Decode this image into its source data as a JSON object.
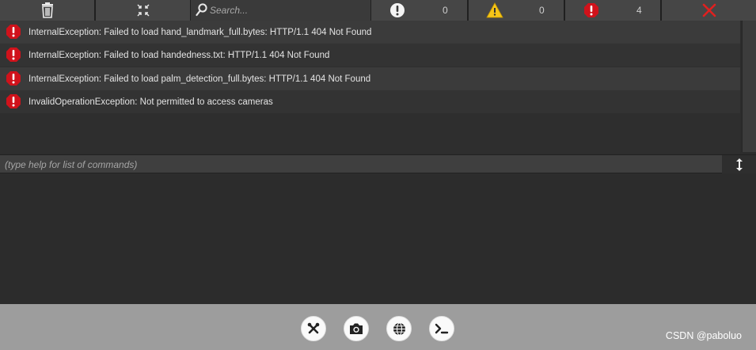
{
  "toolbar": {
    "clear_icon": "trash-icon",
    "collapse_icon": "collapse-arrows-icon",
    "search_placeholder": "Search...",
    "info_count": "0",
    "warning_count": "0",
    "error_count": "4",
    "close_icon": "close-x-icon"
  },
  "colors": {
    "error_red": "#d0121b",
    "warning_yellow": "#f5c518",
    "close_red": "#e0201f",
    "toolbar_bg": "#464646",
    "bottom_bar_bg": "#9d9d9d"
  },
  "logs": [
    {
      "level": "error",
      "text": "InternalException: Failed to load hand_landmark_full.bytes: HTTP/1.1 404 Not Found"
    },
    {
      "level": "error",
      "text": "InternalException: Failed to load handedness.txt: HTTP/1.1 404 Not Found"
    },
    {
      "level": "error",
      "text": "InternalException: Failed to load palm_detection_full.bytes: HTTP/1.1 404 Not Found"
    },
    {
      "level": "error",
      "text": "InvalidOperationException: Not permitted to access cameras"
    }
  ],
  "command": {
    "placeholder": "(type help for list of commands)"
  },
  "bottom_buttons": [
    "tools-icon",
    "camera-icon",
    "globe-icon",
    "terminal-icon"
  ],
  "watermark": "CSDN @paboluo"
}
